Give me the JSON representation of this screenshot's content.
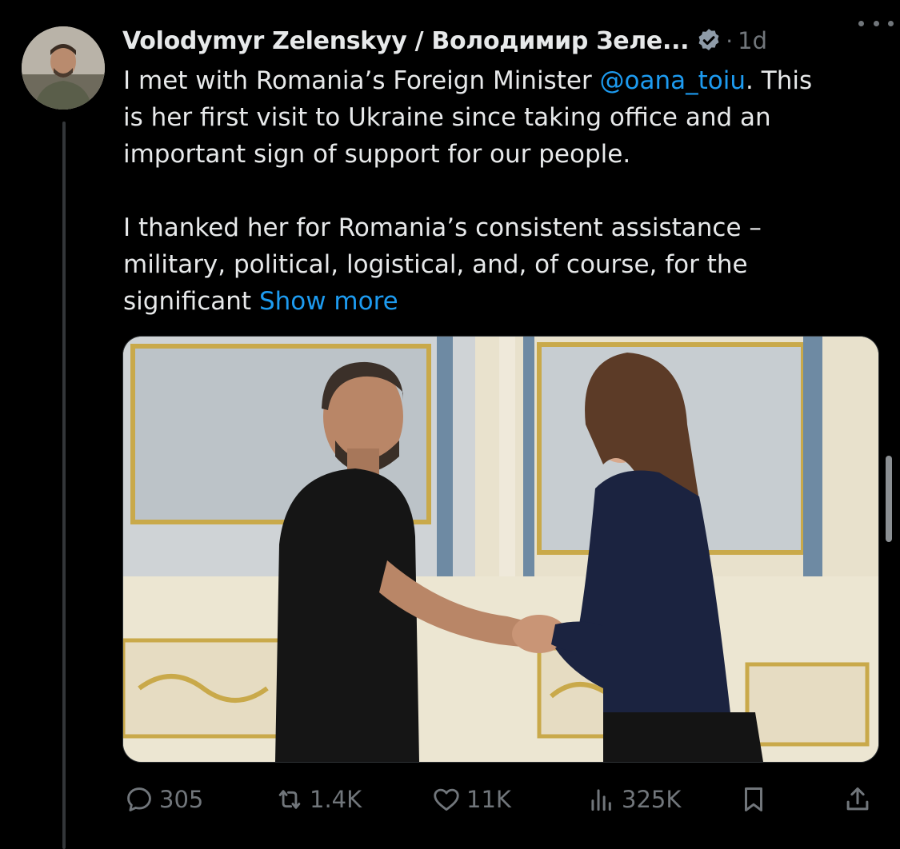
{
  "tweet": {
    "author_name": "Volodymyr Zelenskyy / Володимир Зеле...",
    "separator": "·",
    "time": "1d",
    "text_before_mention": "I met with Romania’s Foreign Minister ",
    "mention": "@oana_toiu",
    "text_after_mention": ". This\nis her first visit to Ukraine since taking office and an\nimportant sign of support for our people.\n\nI thanked her for Romania’s consistent assistance –\nmilitary, political, logistical, and, of course, for the\nsignificant ",
    "show_more": "Show more"
  },
  "actions": {
    "replies": "305",
    "reposts": "1.4K",
    "likes": "11K",
    "views": "325K"
  },
  "icons": {
    "verified": "verified-badge-icon",
    "more": "more-icon",
    "reply": "reply-icon",
    "repost": "repost-icon",
    "like": "heart-icon",
    "views": "views-icon",
    "bookmark": "bookmark-icon",
    "share": "share-icon"
  },
  "colors": {
    "background": "#000000",
    "text": "#e7e9ea",
    "secondary": "#71767b",
    "accent": "#1d9bf0"
  }
}
